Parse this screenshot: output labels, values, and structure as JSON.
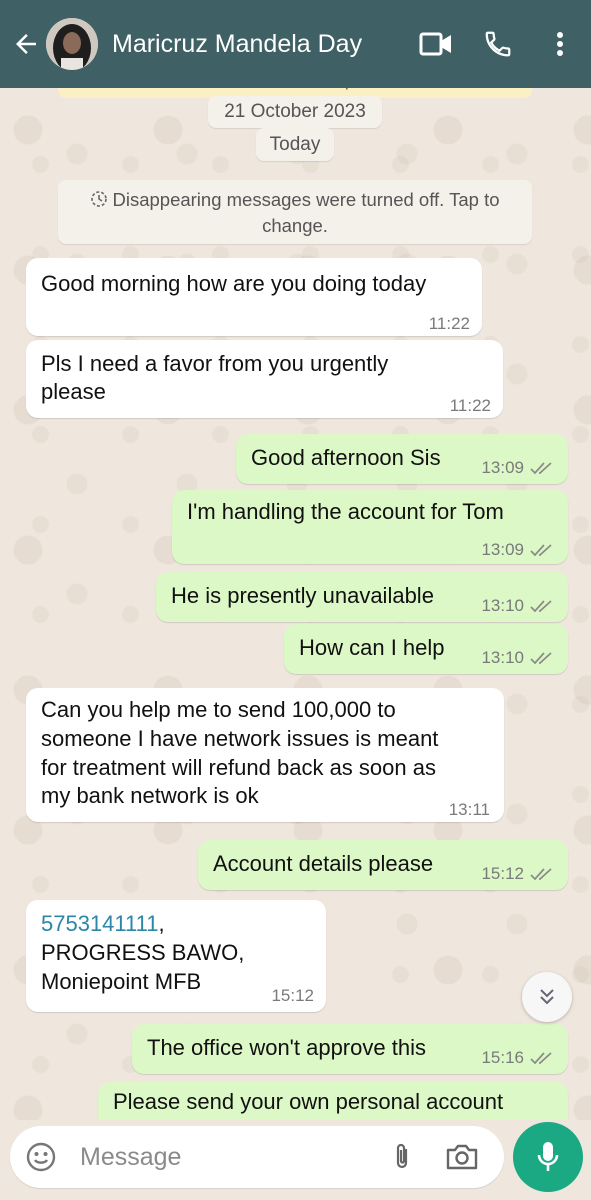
{
  "header": {
    "contact_name": "Maricruz Mandela Day",
    "background": "#3f6064"
  },
  "chat": {
    "encryption_note_fragment": "can read or listen to them. Tap to learn more.",
    "date_label": "21 October 2023",
    "today_label": "Today",
    "system_message_line1": "Disappearing messages were turned off. Tap to",
    "system_message_line2": "change.",
    "messages": [
      {
        "direction": "incoming",
        "lines": [
          "Good morning how are you doing today"
        ],
        "time": "11:22"
      },
      {
        "direction": "incoming",
        "lines": [
          "Pls I need a favor from you urgently",
          "please"
        ],
        "time": "11:22"
      },
      {
        "direction": "outgoing",
        "lines": [
          "Good afternoon Sis"
        ],
        "time": "13:09",
        "status": "read"
      },
      {
        "direction": "outgoing",
        "lines": [
          "I'm handling the account for Tom"
        ],
        "time": "13:09",
        "status": "read"
      },
      {
        "direction": "outgoing",
        "lines": [
          "He is presently unavailable"
        ],
        "time": "13:10",
        "status": "read"
      },
      {
        "direction": "outgoing",
        "lines": [
          "How can I help"
        ],
        "time": "13:10",
        "status": "read"
      },
      {
        "direction": "incoming",
        "lines": [
          "Can you help me to send 100,000 to",
          "someone I have network issues is meant",
          "for treatment will refund back as soon as",
          "my bank network is ok"
        ],
        "time": "13:11"
      },
      {
        "direction": "outgoing",
        "lines": [
          "Account details please"
        ],
        "time": "15:12",
        "status": "read"
      },
      {
        "direction": "incoming",
        "link": "5753141111",
        "lines": [
          ",",
          "PROGRESS BAWO,",
          "Moniepoint MFB"
        ],
        "time": "15:12"
      },
      {
        "direction": "outgoing",
        "lines": [
          "The office won't approve this"
        ],
        "time": "15:16",
        "status": "read"
      },
      {
        "direction": "outgoing",
        "lines": [
          "Please send your own personal account"
        ],
        "time": "",
        "status": ""
      }
    ]
  },
  "composer": {
    "placeholder": "Message"
  },
  "colors": {
    "incoming_bubble": "#ffffff",
    "outgoing_bubble": "#dcf8c6",
    "chat_background": "#efe7de",
    "accent": "#1aa983",
    "link": "#2b87a5"
  },
  "icons": [
    "back-arrow-icon",
    "video-call-icon",
    "phone-icon",
    "more-vert-icon",
    "timer-icon",
    "double-check-icon",
    "chevron-double-down-icon",
    "emoji-icon",
    "attach-icon",
    "camera-icon",
    "mic-icon"
  ]
}
